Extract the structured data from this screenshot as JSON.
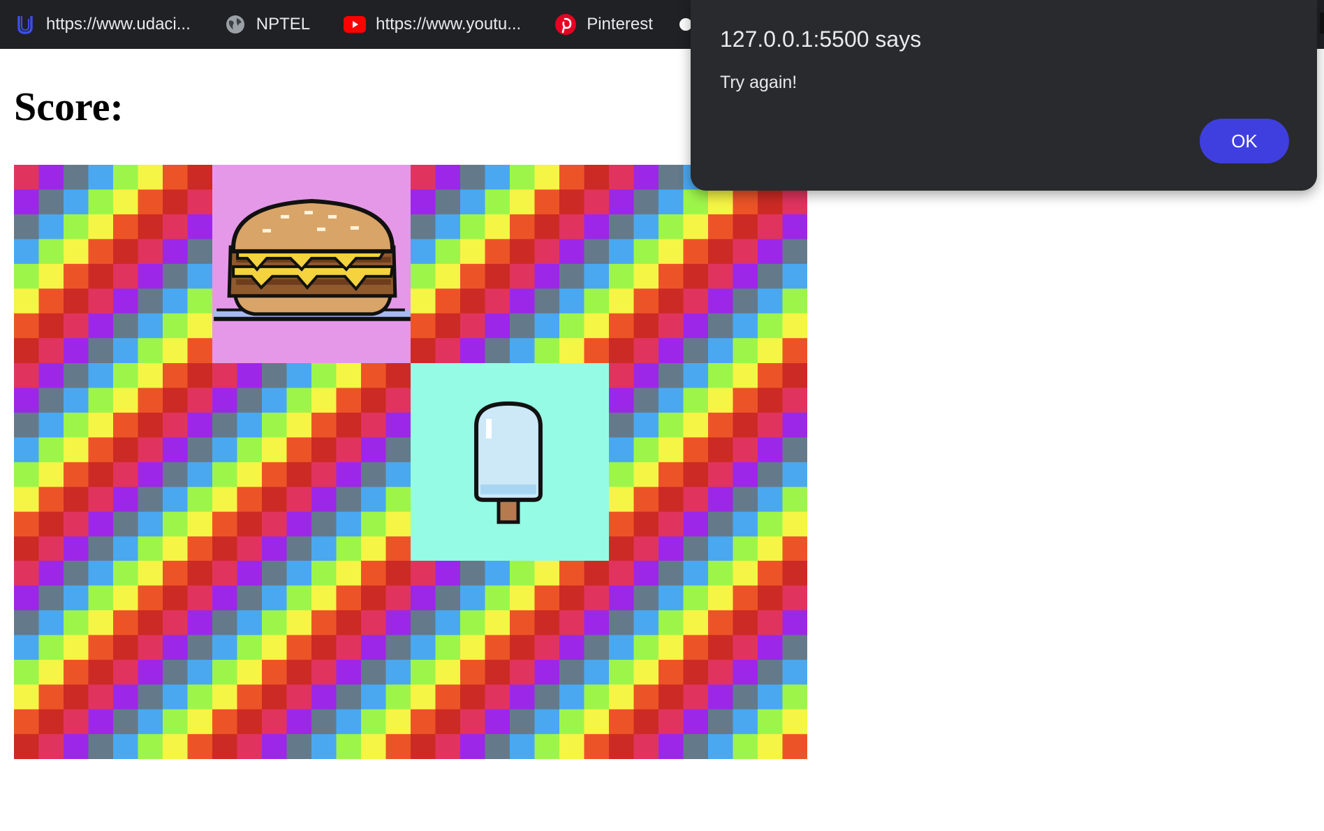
{
  "bookmarks": [
    {
      "label": "https://www.udaci...",
      "icon": "udacity-icon"
    },
    {
      "label": "NPTEL",
      "icon": "globe-icon"
    },
    {
      "label": "https://www.youtu...",
      "icon": "youtube-icon"
    },
    {
      "label": "Pinterest",
      "icon": "pinterest-icon"
    }
  ],
  "page": {
    "score_label": "Score:"
  },
  "board": {
    "rows": 3,
    "cols": 4,
    "cards": [
      {
        "state": "hidden"
      },
      {
        "state": "revealed",
        "item": "burger"
      },
      {
        "state": "hidden"
      },
      {
        "state": "hidden"
      },
      {
        "state": "hidden"
      },
      {
        "state": "hidden"
      },
      {
        "state": "revealed",
        "item": "popsicle"
      },
      {
        "state": "hidden"
      },
      {
        "state": "hidden"
      },
      {
        "state": "hidden"
      },
      {
        "state": "hidden"
      },
      {
        "state": "hidden"
      }
    ],
    "card_back_palette": [
      "#e0345f",
      "#9c27e8",
      "#647a8a",
      "#4aa8f0",
      "#9ef54a",
      "#f5f545",
      "#ec5428",
      "#cc2a24"
    ],
    "revealed_colors": {
      "burger": "#e598e8",
      "popsicle": "#96fbe4"
    }
  },
  "dialog": {
    "title": "127.0.0.1:5500 says",
    "message": "Try again!",
    "ok_label": "OK",
    "ok_color": "#3f3fe0"
  }
}
